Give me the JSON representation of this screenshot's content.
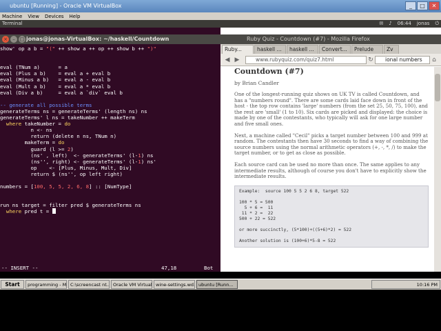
{
  "vbox": {
    "title": "ubuntu [Running] - Oracle VM VirtualBox",
    "menu": [
      "Machine",
      "View",
      "Devices",
      "Help"
    ]
  },
  "ubuntu_panel": {
    "app": "Terminal",
    "clock": "06:44",
    "user": "jonas"
  },
  "terminal": {
    "path": "jonas@jonas-VirtualBox: ~/haskell/Countdown",
    "lines": [
      [
        {
          "t": "show' op a b = ",
          "c": ""
        },
        {
          "t": "\"(\"",
          "c": "str"
        },
        {
          "t": " ++ show a ++ op ++ show b ++ ",
          "c": ""
        },
        {
          "t": "\")\"",
          "c": "str"
        }
      ],
      [],
      [],
      [
        {
          "t": "eval (TNum a)      = a",
          "c": ""
        }
      ],
      [
        {
          "t": "eval (Plus a b)    = eval a + eval b",
          "c": ""
        }
      ],
      [
        {
          "t": "eval (Minus a b)   = eval a - eval b",
          "c": ""
        }
      ],
      [
        {
          "t": "eval (Mult a b)    = eval a * eval b",
          "c": ""
        }
      ],
      [
        {
          "t": "eval (Div a b)     = eval a `div` eval b",
          "c": ""
        }
      ],
      [],
      [
        {
          "t": "-- generate all possible terms",
          "c": "cmt"
        }
      ],
      [
        {
          "t": "generateTerms ns = generateTerms' (length ns) ns",
          "c": ""
        }
      ],
      [
        {
          "t": "generateTerms' l ns = takeNumber ++ makeTerm",
          "c": ""
        }
      ],
      [
        {
          "t": "  where ",
          "c": "kw"
        },
        {
          "t": "takeNumber = ",
          "c": ""
        },
        {
          "t": "do",
          "c": "kw"
        }
      ],
      [
        {
          "t": "          n <- ns",
          "c": ""
        }
      ],
      [
        {
          "t": "          return (delete n ns, TNum n)",
          "c": ""
        }
      ],
      [
        {
          "t": "        makeTerm = ",
          "c": ""
        },
        {
          "t": "do",
          "c": "kw"
        }
      ],
      [
        {
          "t": "          guard (l >= ",
          "c": ""
        },
        {
          "t": "2",
          "c": "num"
        },
        {
          "t": ")",
          "c": ""
        }
      ],
      [
        {
          "t": "          (ns' , left)  <- generateTerms' (l-",
          "c": ""
        },
        {
          "t": "1",
          "c": "num"
        },
        {
          "t": ") ns",
          "c": ""
        }
      ],
      [
        {
          "t": "          (ns'', right) <- generateTerms' (l-",
          "c": ""
        },
        {
          "t": "1",
          "c": "num"
        },
        {
          "t": ") ns'",
          "c": ""
        }
      ],
      [
        {
          "t": "          op    <- [Plus, Minus, Mult, Div]",
          "c": ""
        }
      ],
      [
        {
          "t": "          return $ (ns'', op left right)",
          "c": ""
        }
      ],
      [],
      [
        {
          "t": "numbers = [",
          "c": ""
        },
        {
          "t": "100, 5, 5, 2, 6, 8",
          "c": "num"
        },
        {
          "t": "] :: [NumType]",
          "c": ""
        }
      ],
      [],
      [],
      [
        {
          "t": "run ns target = filter pred $ generateTerms ns",
          "c": ""
        }
      ],
      [
        {
          "t": "  where ",
          "c": "kw"
        },
        {
          "t": "pred t = ",
          "c": ""
        }
      ]
    ],
    "status_mode": "-- INSERT --",
    "status_pos": "47,18",
    "status_scroll": "Bot"
  },
  "firefox": {
    "window_title": "Ruby Quiz - Countdown (#7) - Mozilla Firefox",
    "tabs": [
      "Ruby...",
      "haskell ...",
      "haskell ...",
      "Convert...",
      "Prelude",
      "Zv"
    ],
    "url": "www.rubyquiz.com/quiz7.html",
    "search": "ional numbers",
    "heading": "Countdown (#7)",
    "byline": "by Brian Candler",
    "p1": "One of the longest-running quiz shows on UK TV is called Countdown, and has a \"numbers round\". There are some cards laid face down in front of the host - the top row contains 'large' numbers (from the set 25, 50, 75, 100), and the rest are 'small' (1 to 10). Six cards are picked and displayed: the choice is made by one of the contestants, who typically will ask for one large number and five small ones.",
    "p2": "Next, a machine called \"Cecil\" picks a target number between 100 and 999 at random. The contestants then have 30 seconds to find a way of combining the source numbers using the normal arithmetic operators (+, -, *, /) to make the target number, or to get as close as possible.",
    "p3": "Each source card can be used no more than once. The same applies to any intermediate results, although of course you don't have to explicitly show the intermediate results.",
    "example": "Example:  source 100 5 5 2 6 8, target 522\n\n100 * 5 = 500\n  5 + 6 =  11\n 11 * 2 =  22\n500 + 22 = 522\n\nor more succinctly, (5*100)+((5+6)*2) = 522\n\nAnother solution is (100+6)*5-8 = 522"
  },
  "taskbar": {
    "start": "Start",
    "tasks": [
      "programming - M...",
      "C:\\screencast nt...",
      "Oracle VM Virtual...",
      "wine-settings.wd...",
      "ubuntu [Runn..."
    ],
    "clock": "10:16 PM"
  }
}
